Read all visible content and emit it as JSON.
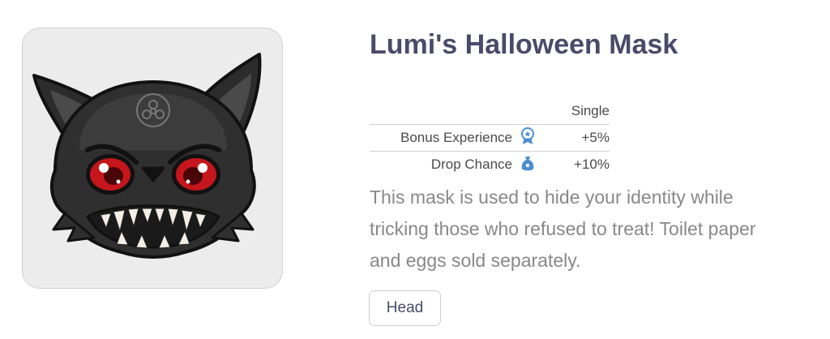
{
  "item": {
    "title": "Lumi's Halloween Mask",
    "image_icon": "black-cat-halloween-mask",
    "stats": {
      "column_header": "Single",
      "rows": [
        {
          "label": "Bonus Experience",
          "icon": "experience-badge-icon",
          "value": "+5%"
        },
        {
          "label": "Drop Chance",
          "icon": "loot-bag-icon",
          "value": "+10%"
        }
      ]
    },
    "description": "This mask is used to hide your identity while tricking those who refused to treat! Toilet paper and eggs sold separately.",
    "slot_tag": "Head"
  },
  "colors": {
    "title": "#4a4a6a",
    "description": "#888888",
    "icon_blue": "#4a8fd0",
    "eye_red": "#c4161c"
  }
}
